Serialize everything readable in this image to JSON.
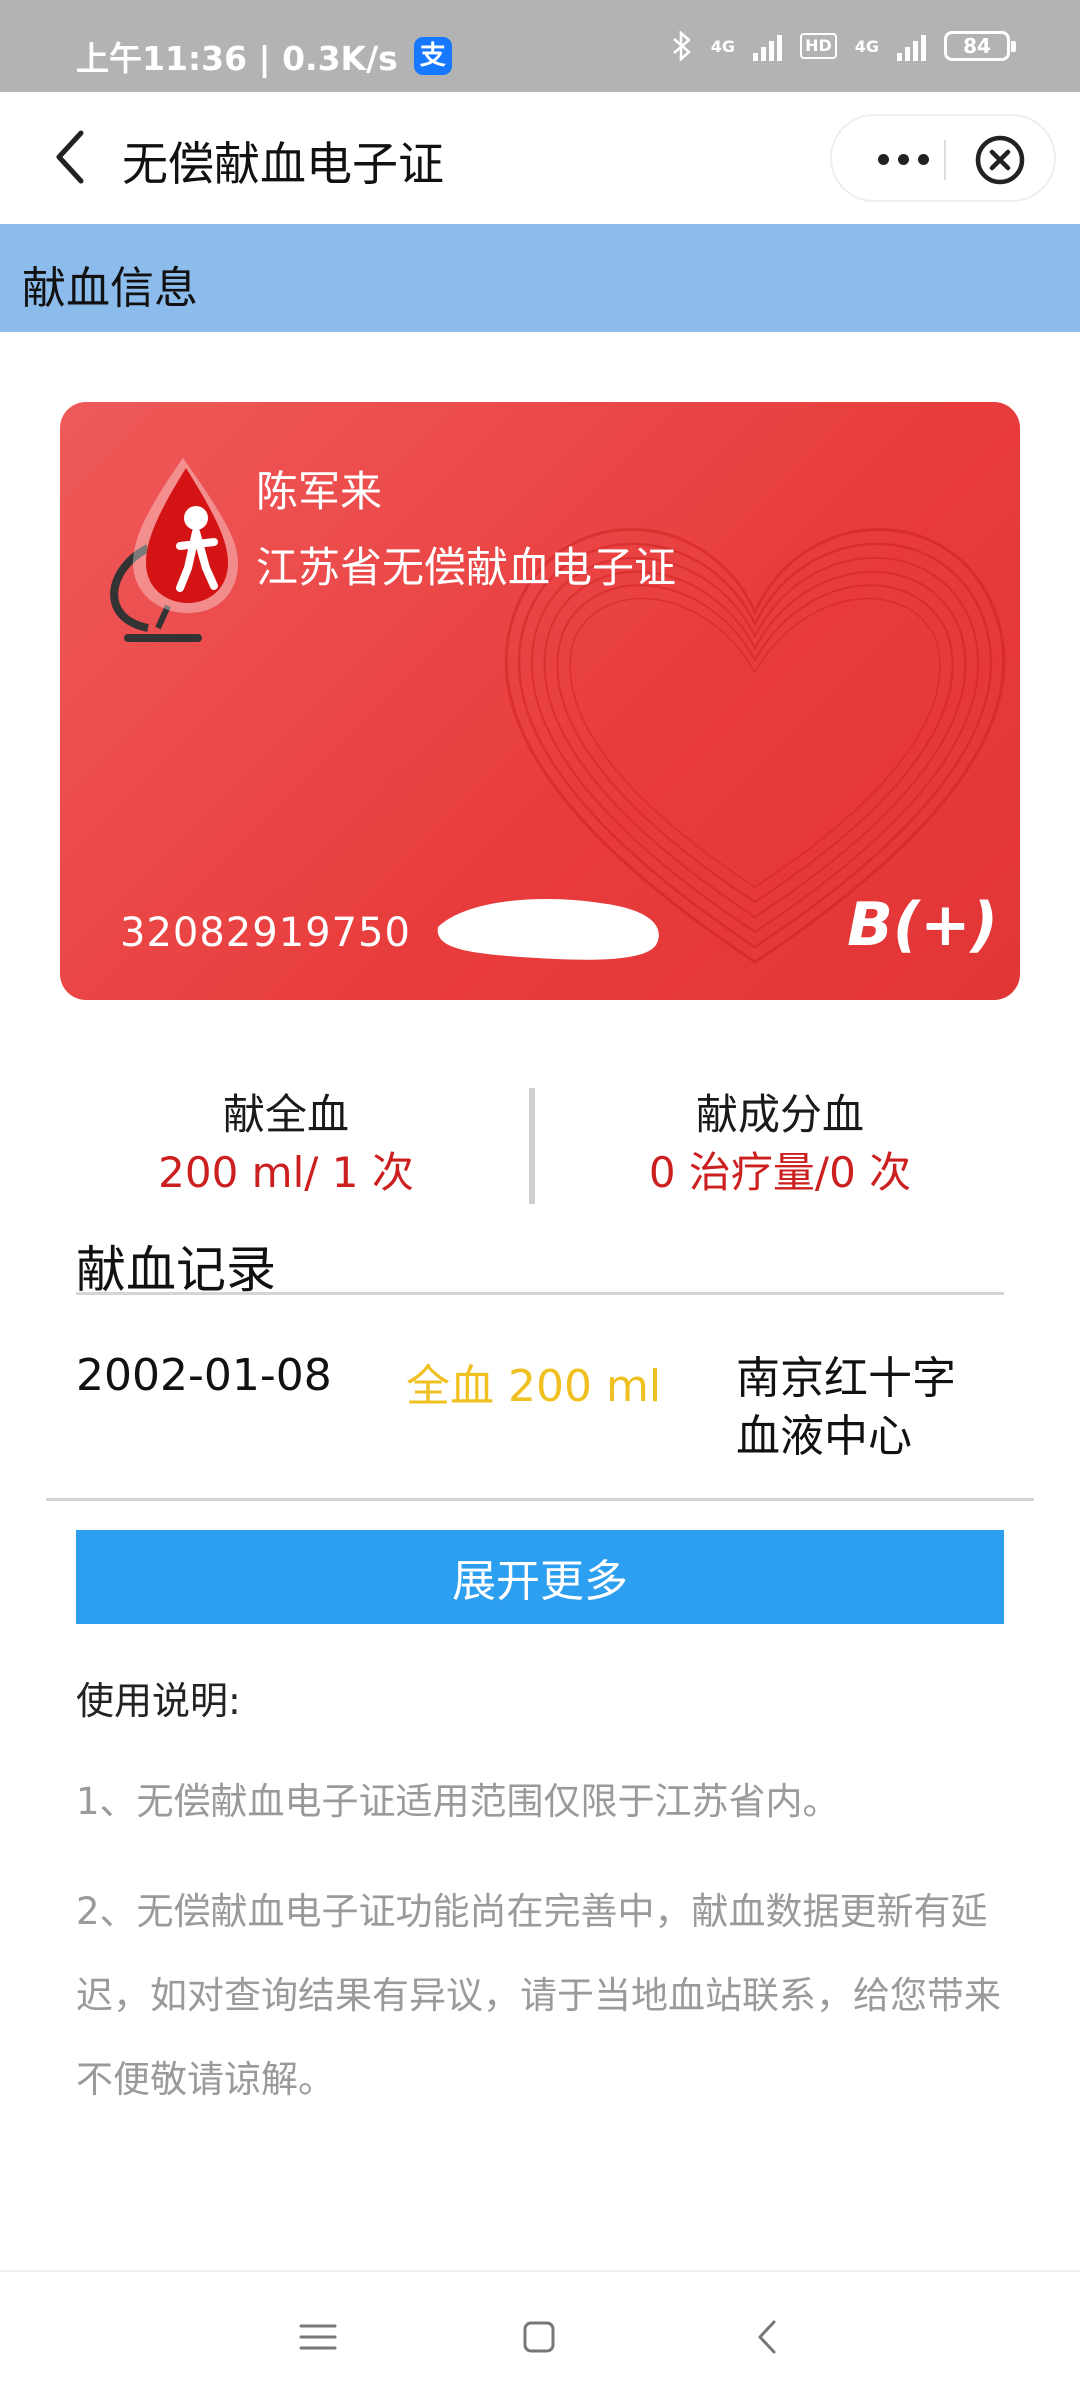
{
  "status_bar": {
    "time_speed": "上午11:36 | 0.3K/s",
    "app_badge": "支",
    "net1": "4G",
    "hd": "HD",
    "net2": "4G",
    "battery": "84"
  },
  "title_bar": {
    "title": "无偿献血电子证"
  },
  "section": {
    "title": "献血信息"
  },
  "card": {
    "holder_name": "陈军来",
    "card_title": "江苏省无偿献血电子证",
    "id_number_visible": "32082919750",
    "blood_type": "B(+)",
    "colors": {
      "card": "#e83b3b"
    }
  },
  "stats": {
    "whole_blood_label": "献全血",
    "whole_blood_value": "200 ml/ 1 次",
    "component_label": "献成分血",
    "component_value": "0 治疗量/0 次"
  },
  "records": {
    "title": "献血记录",
    "rows": [
      {
        "date": "2002-01-08",
        "type": "全血 200 ml",
        "place": "南京红十字血液中心"
      }
    ]
  },
  "expand_button": "展开更多",
  "instructions": {
    "title": "使用说明:",
    "items": [
      "1、无偿献血电子证适用范围仅限于江苏省内。",
      "2、无偿献血电子证功能尚在完善中，献血数据更新有延迟，如对查询结果有异议，请于当地血站联系，给您带来不便敬请谅解。"
    ]
  },
  "nav": {
    "icons": [
      "menu-icon",
      "home-icon",
      "back-icon"
    ]
  }
}
